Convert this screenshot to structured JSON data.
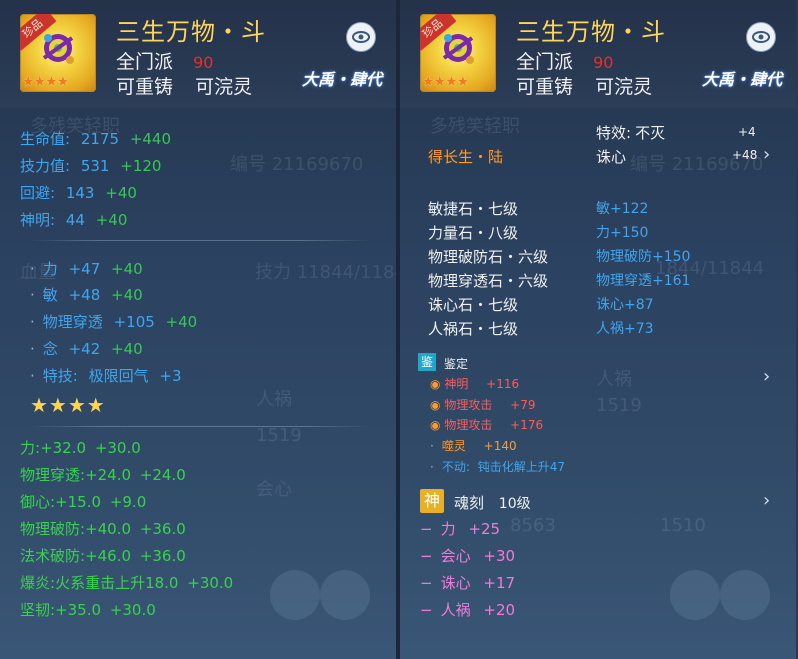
{
  "left": {
    "badge": "珍品",
    "title": "三生万物・斗",
    "sect_label": "全门派",
    "sect_value": "90",
    "recast": "可重铸",
    "wash": "可浣灵",
    "era": "大禹・肆代",
    "stats": [
      {
        "label": "生命值:",
        "value": "2175",
        "bonus": "+440"
      },
      {
        "label": "技力值:",
        "value": "531",
        "bonus": "+120"
      },
      {
        "label": "回避:",
        "value": "143",
        "bonus": "+40"
      },
      {
        "label": "神明:",
        "value": "44",
        "bonus": "+40"
      }
    ],
    "attrs": [
      {
        "label": "力",
        "value": "+47",
        "bonus": "+40"
      },
      {
        "label": "敏",
        "value": "+48",
        "bonus": "+40"
      },
      {
        "label": "物理穿透",
        "value": "+105",
        "bonus": "+40"
      },
      {
        "label": "念",
        "value": "+42",
        "bonus": "+40"
      },
      {
        "label": "特技:",
        "value": "极限回气",
        "bonus": "+3"
      }
    ],
    "stars": "★★★★",
    "extras": [
      {
        "label": "力:",
        "value": "+32.0",
        "bonus": "+30.0"
      },
      {
        "label": "物理穿透:",
        "value": "+24.0",
        "bonus": "+24.0"
      },
      {
        "label": "御心:",
        "value": "+15.0",
        "bonus": "+9.0"
      },
      {
        "label": "物理破防:",
        "value": "+40.0",
        "bonus": "+36.0"
      },
      {
        "label": "法术破防:",
        "value": "+46.0",
        "bonus": "+36.0"
      },
      {
        "label": "爆炎:",
        "value": "火系重击上升18.0",
        "bonus": "+30.0"
      },
      {
        "label": "坚韧:",
        "value": "+35.0",
        "bonus": "+30.0"
      }
    ]
  },
  "right": {
    "badge": "珍品",
    "title": "三生万物・斗",
    "sect_label": "全门派",
    "sect_value": "90",
    "recast": "可重铸",
    "wash": "可浣灵",
    "era": "大禹・肆代",
    "growth": "得长生・陆",
    "effect_label": "特效:",
    "effect_value": "不灭",
    "effect_num": "+4",
    "zhuxin_label": "诛心",
    "zhuxin_num": "+48",
    "gems": [
      {
        "name": "敏捷石・七级",
        "effect": "敏+122"
      },
      {
        "name": "力量石・八级",
        "effect": "力+150"
      },
      {
        "name": "物理破防石・六级",
        "effect": "物理破防+150"
      },
      {
        "name": "物理穿透石・六级",
        "effect": "物理穿透+161"
      },
      {
        "name": "诛心石・七级",
        "effect": "诛心+87"
      },
      {
        "name": "人祸石・七级",
        "effect": "人祸+73"
      }
    ],
    "identify_tag": "鉴",
    "identify_label": "鉴定",
    "identify_items": [
      {
        "name": "神明",
        "value": "+116"
      },
      {
        "name": "物理攻击",
        "value": "+79"
      },
      {
        "name": "物理攻击",
        "value": "+176"
      }
    ],
    "bite_label": "噬灵",
    "bite_value": "+140",
    "immobile_label": "不动:",
    "immobile_value": "钝击化解上升47",
    "soul_tag": "神",
    "soul_label": "魂刻",
    "soul_level": "10级",
    "soul_items": [
      {
        "label": "力",
        "value": "+25"
      },
      {
        "label": "会心",
        "value": "+30"
      },
      {
        "label": "诛心",
        "value": "+17"
      },
      {
        "label": "人祸",
        "value": "+20"
      }
    ]
  }
}
